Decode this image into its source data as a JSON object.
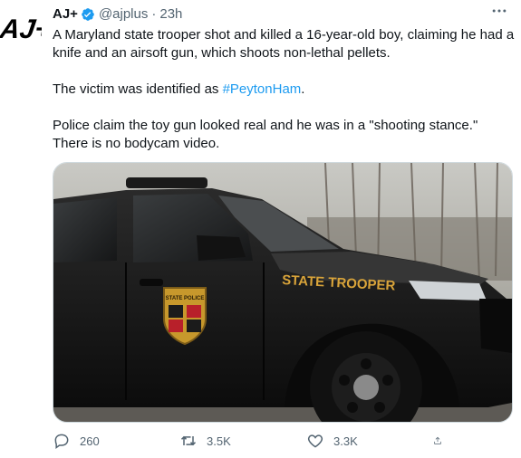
{
  "author": {
    "name": "AJ+",
    "handle": "@ajplus",
    "time": "23h",
    "logo_text": "AJ+"
  },
  "tweet": {
    "line1": "A Maryland state trooper shot and killed a 16-year-old boy, claiming he had a knife and an airsoft gun, which shoots non-lethal pellets.",
    "line2_prefix": "The victim was identified as ",
    "hashtag": "#PeytonHam",
    "line2_suffix": ".",
    "line3": "Police claim the toy gun looked real and he was in a \"shooting stance.\" There is no bodycam video."
  },
  "media": {
    "door_text": "STATE TROOPER",
    "seal_text": "STATE POLICE"
  },
  "actions": {
    "replies": "260",
    "retweets": "3.5K",
    "likes": "3.3K"
  },
  "colors": {
    "link": "#1d9bf0",
    "muted": "#536471",
    "verified": "#1d9bf0",
    "car_gold": "#d9a43a"
  },
  "icons": [
    "verified-icon",
    "more-icon",
    "reply-icon",
    "retweet-icon",
    "like-icon",
    "share-icon"
  ]
}
